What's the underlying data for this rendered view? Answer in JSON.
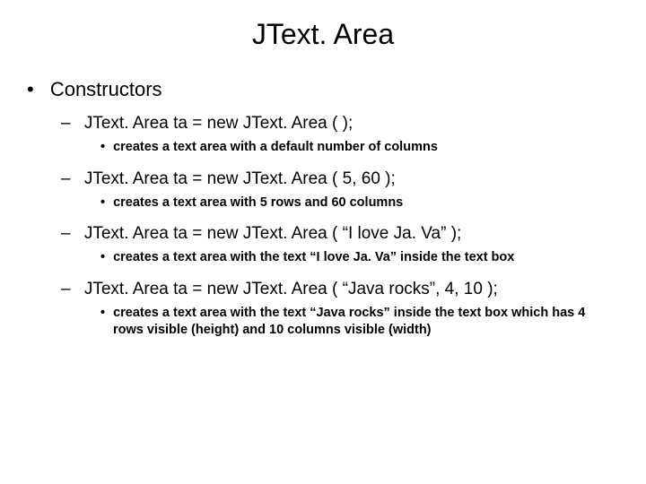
{
  "title": "JText. Area",
  "section": "Constructors",
  "constructors": [
    {
      "signature": "JText. Area ta = new JText. Area ( );",
      "description": "creates a text area with a default number of columns"
    },
    {
      "signature": "JText. Area ta = new JText. Area ( 5, 60 );",
      "description": "creates a text area with 5 rows and 60 columns"
    },
    {
      "signature": "JText. Area ta = new JText. Area ( “I love Ja. Va” );",
      "description": "creates a text area with the text “I love Ja. Va” inside the text box"
    },
    {
      "signature": "JText. Area ta = new JText. Area ( “Java rocks”, 4, 10 );",
      "description": "creates a text area with the text “Java rocks” inside the text box which has 4 rows visible (height) and 10 columns visible (width)"
    }
  ]
}
